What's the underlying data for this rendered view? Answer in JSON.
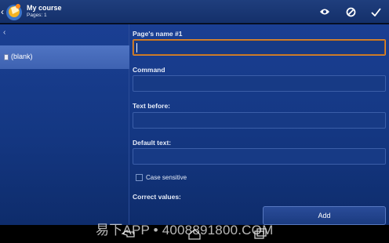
{
  "header": {
    "title": "My course",
    "subtitle": "Pages: 1",
    "actions": [
      {
        "name": "preview-icon"
      },
      {
        "name": "cancel-icon"
      },
      {
        "name": "confirm-check-icon"
      }
    ]
  },
  "sidebar": {
    "back_icon": "chevron-left-icon",
    "items": [
      {
        "label": "(blank)",
        "icon": "page-icon"
      }
    ]
  },
  "form": {
    "page_name_label": "Page's name #1",
    "page_name_value": "",
    "command_label": "Command",
    "command_value": "",
    "text_before_label": "Text before:",
    "text_before_value": "",
    "default_text_label": "Default text:",
    "default_text_value": "",
    "case_sensitive_label": "Case sensitive",
    "case_sensitive_checked": false,
    "correct_values_label": "Correct values:",
    "add_button_label": "Add"
  },
  "navigation": [
    "back-icon",
    "home-icon",
    "recent-apps-icon"
  ],
  "watermark": "易下APP • 4008891800.COM",
  "colors": {
    "actionbar": "#1a377a",
    "panel": "#143782",
    "selected_item": "#4a6fbf",
    "focus_border": "#e58a2c"
  }
}
